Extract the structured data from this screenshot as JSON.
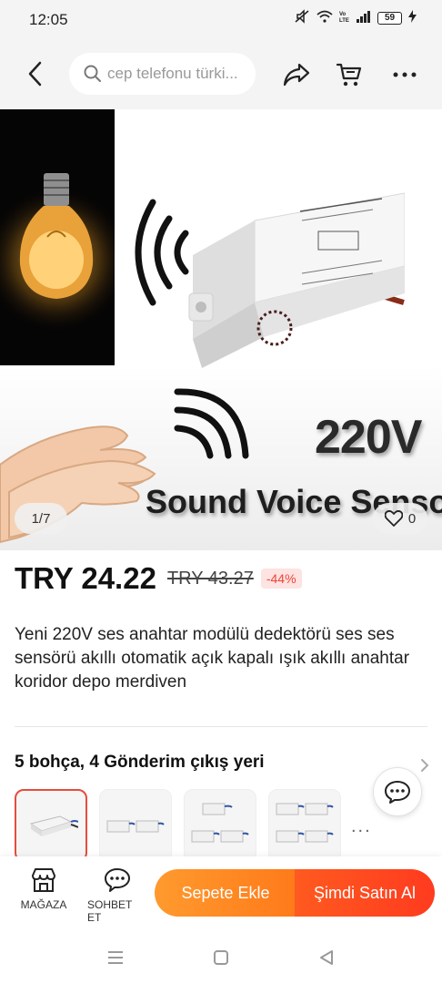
{
  "status_bar": {
    "time": "12:05",
    "battery": "59"
  },
  "search": {
    "placeholder": "cep telefonu türki..."
  },
  "gallery": {
    "counter": "1/7",
    "likes": "0",
    "overlay_voltage": "220V",
    "overlay_caption": "Sound Voice Sensor"
  },
  "price": {
    "current": "TRY 24.22",
    "original": "TRY 43.27",
    "discount": "-44%"
  },
  "product": {
    "title": "Yeni 220V ses anahtar modülü dedektörü ses ses sensörü akıllı otomatik açık kapalı ışık akıllı anahtar koridor depo merdiven"
  },
  "variants": {
    "heading": "5 bohça, 4 Gönderim çıkış yeri",
    "more": "..."
  },
  "bottom_bar": {
    "store_label": "MAĞAZA",
    "chat_label": "SOHBET ET",
    "add_to_cart": "Sepete Ekle",
    "buy_now": "Şimdi Satın Al"
  },
  "colors": {
    "accent_orange": "#ff8a25",
    "accent_red": "#ff4a1f",
    "discount_red": "#f0433a"
  }
}
